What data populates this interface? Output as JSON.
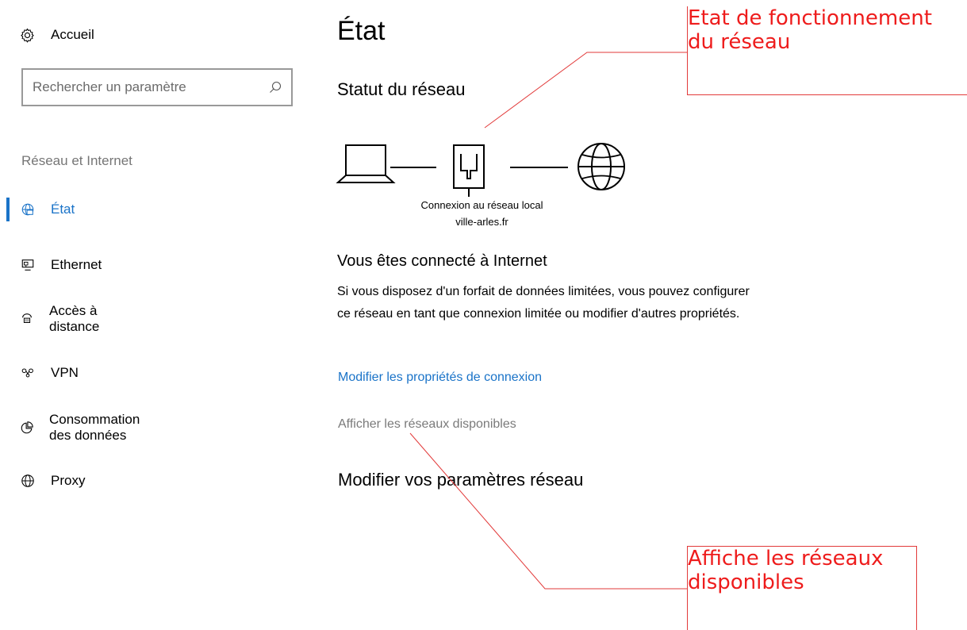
{
  "sidebar": {
    "home_label": "Accueil",
    "search_placeholder": "Rechercher un paramètre",
    "section_label": "Réseau et Internet",
    "items": [
      {
        "label": "État",
        "icon": "network-status-icon",
        "active": true
      },
      {
        "label": "Ethernet",
        "icon": "ethernet-icon",
        "active": false
      },
      {
        "label": "Accès à distance",
        "icon": "dialup-icon",
        "active": false
      },
      {
        "label": "VPN",
        "icon": "vpn-icon",
        "active": false
      },
      {
        "label": "Consommation des données",
        "icon": "data-usage-icon",
        "active": false
      },
      {
        "label": "Proxy",
        "icon": "globe-icon",
        "active": false
      }
    ]
  },
  "main": {
    "title": "État",
    "network_status_heading": "Statut du réseau",
    "connection_name": "Connexion au réseau local",
    "domain": "ville-arles.fr",
    "connected_title": "Vous êtes connecté à Internet",
    "description": "Si vous disposez d'un forfait de données limitées, vous pouvez configurer ce réseau en tant que connexion limitée ou modifier d'autres propriétés.",
    "change_properties_link": "Modifier les propriétés de connexion",
    "show_networks_link": "Afficher les réseaux disponibles",
    "change_settings_heading": "Modifier vos paramètres réseau"
  },
  "annotations": {
    "callout_status": "Etat de fonctionnement\ndu réseau",
    "callout_networks": "Affiche les réseaux\ndisponibles"
  },
  "colors": {
    "accent": "#1a73c8",
    "annotation": "#ee1c1c",
    "muted_text": "#767676"
  }
}
